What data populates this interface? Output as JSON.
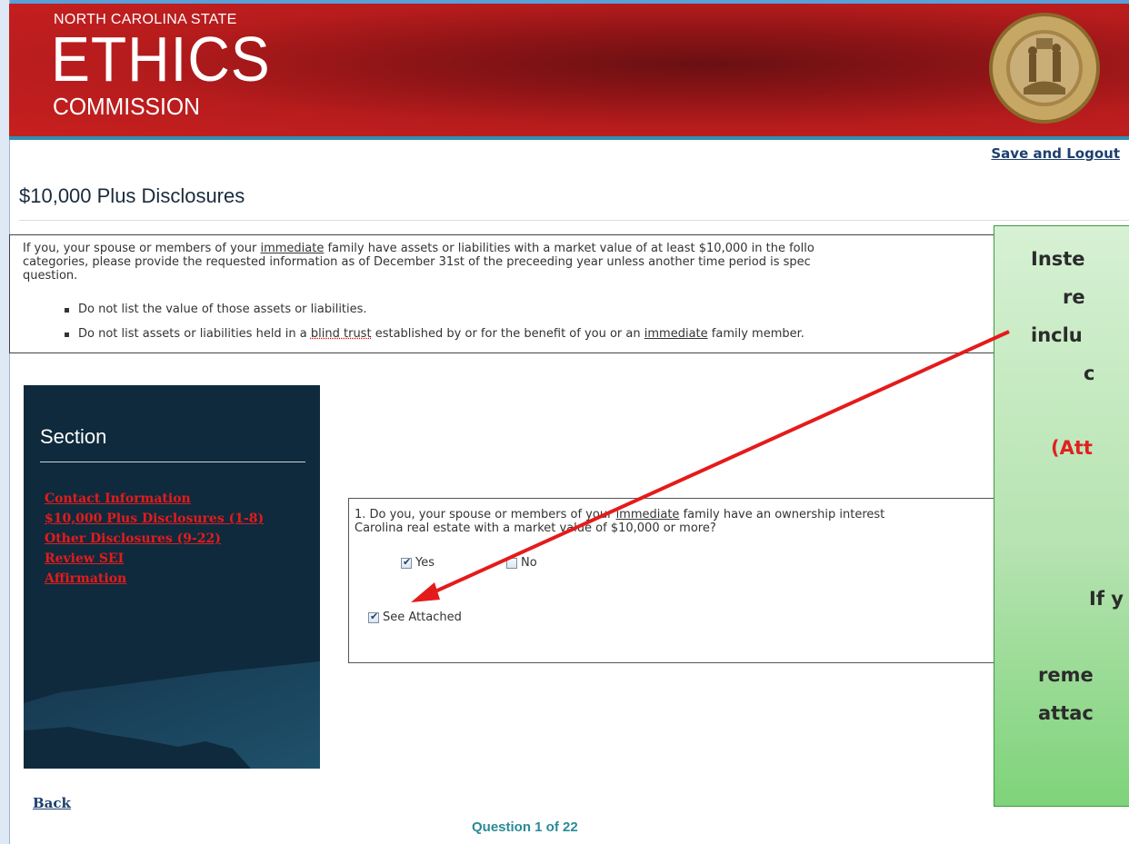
{
  "header": {
    "org_line": "NORTH CAROLINA STATE",
    "org_main": "ETHICS",
    "org_sub": "COMMISSION",
    "seal_icon": "nc-state-seal-icon"
  },
  "top_links": {
    "save_logout": "Save and Logout"
  },
  "page": {
    "title": "$10,000 Plus Disclosures"
  },
  "instructions": {
    "p1": "If you, your spouse or members of your",
    "p1_link": "immediate",
    "p2": "family have assets or liabilities with a market value of at least $10,000 in the follo",
    "p3": "categories, please provide the requested information as of December 31st of the preceeding year unless another time period is spec",
    "p4": "question.",
    "bullet1": "Do not list the value of those assets or liabilities.",
    "bullet2_a": "Do not list assets or liabilities held in a",
    "bullet2_link": "blind trust",
    "bullet2_b": "established by or for the benefit of you or an",
    "bullet2_link2": "immediate",
    "bullet2_c": "family member."
  },
  "sidebar": {
    "title": "Section",
    "items": [
      {
        "label": "Contact Information"
      },
      {
        "label": "$10,000 Plus Disclosures (1-8)"
      },
      {
        "label": "Other Disclosures (9-22)"
      },
      {
        "label": "Review SEI"
      },
      {
        "label": "Affirmation"
      }
    ]
  },
  "question": {
    "line1_a": "1. Do you, your spouse or members of your",
    "line1_link": "immediate",
    "line1_b": "family have an ownership interest",
    "line2": "Carolina real estate with a market value of $10,000 or more?",
    "yes_label": "Yes",
    "yes_checked": true,
    "no_label": "No",
    "no_checked": false,
    "see_attached_label": "See Attached",
    "see_attached_checked": true
  },
  "footer": {
    "back_label": "Back",
    "progress": "Question  1 of 22"
  },
  "callout": {
    "line1": "Inste",
    "line2": "re",
    "line3": "inclu",
    "line4": "c",
    "line5": "(Att",
    "line6": "If y",
    "line7": "reme",
    "line8": "attac"
  },
  "colors": {
    "banner_red": "#b71c1d",
    "sidebar_bg": "#0f2a3d",
    "link_red": "#e41b1b",
    "callout_green": "#b6e3b1",
    "arrow_red": "#e41b1b"
  }
}
